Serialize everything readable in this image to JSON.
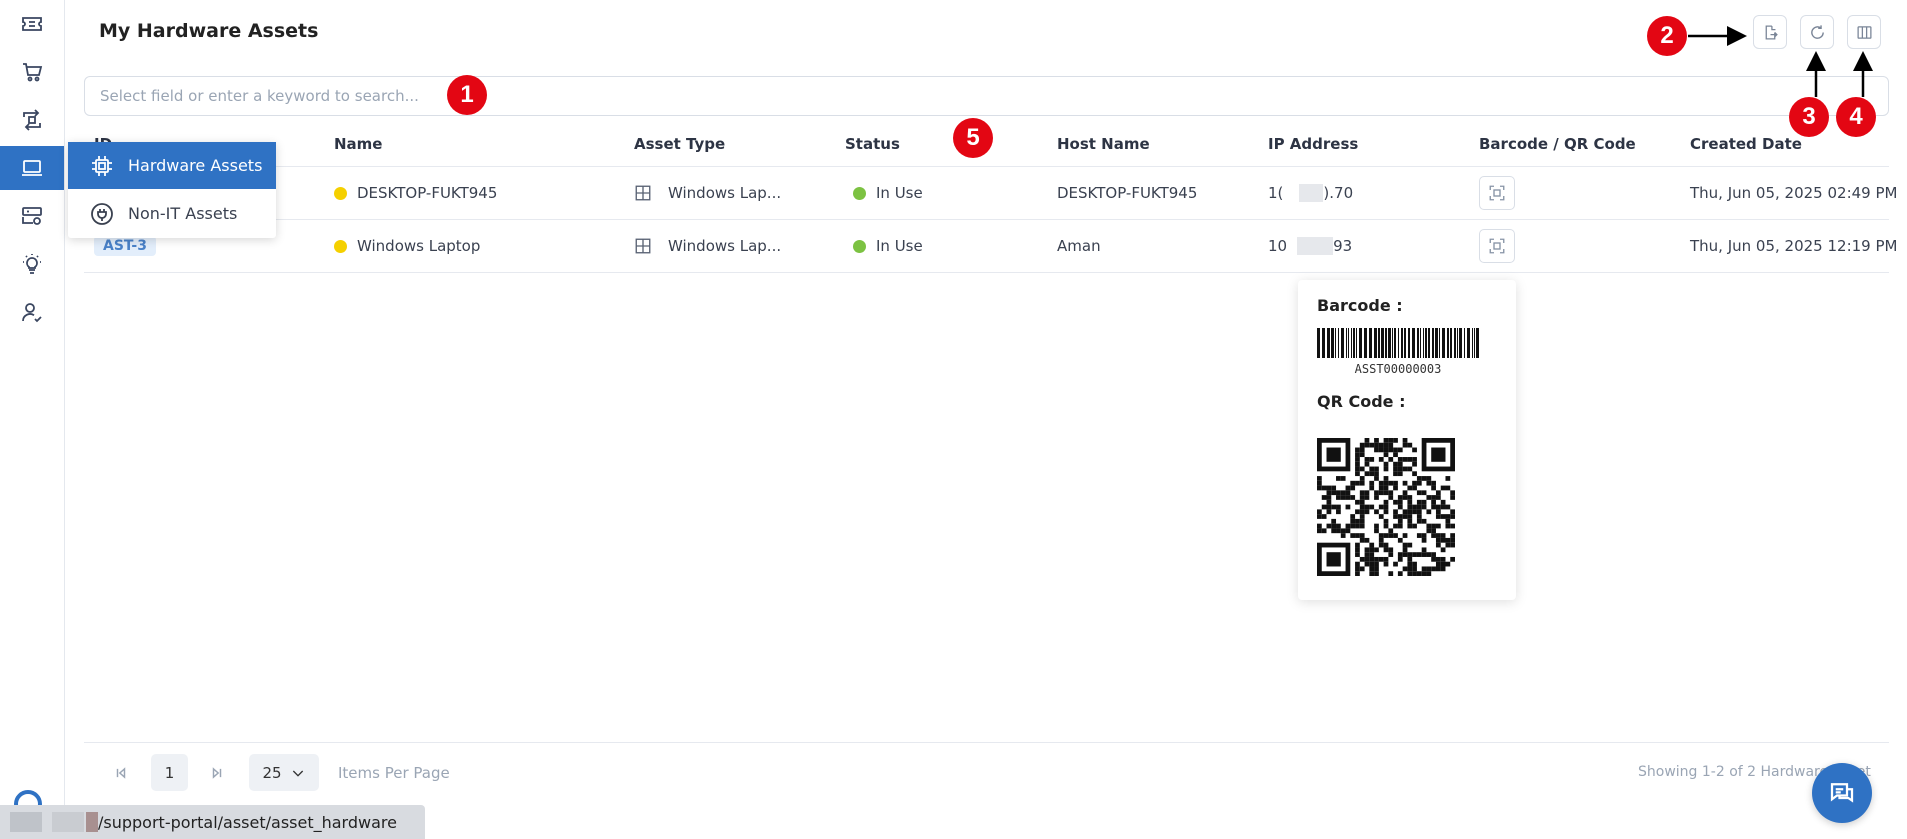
{
  "page": {
    "title": "My Hardware Assets"
  },
  "sidebar": {
    "items": [
      {
        "icon": "ticket-icon"
      },
      {
        "icon": "cart-icon"
      },
      {
        "icon": "transfer-icon"
      },
      {
        "icon": "laptop-icon",
        "active": true
      },
      {
        "icon": "server-icon"
      },
      {
        "icon": "lightbulb-icon"
      },
      {
        "icon": "user-check-icon"
      }
    ]
  },
  "toolbar": {
    "icons": [
      "export-icon",
      "refresh-icon",
      "columns-icon"
    ]
  },
  "search": {
    "placeholder": "Select field or enter a keyword to search..."
  },
  "asset_menu": {
    "items": [
      {
        "label": "Hardware Assets",
        "icon": "chip-icon",
        "active": true
      },
      {
        "label": "Non-IT Assets",
        "icon": "plug-icon",
        "active": false
      }
    ]
  },
  "table": {
    "columns": [
      "ID",
      "Name",
      "Asset Type",
      "Status",
      "Host Name",
      "IP Address",
      "Barcode / QR Code",
      "Created Date"
    ],
    "rows": [
      {
        "id": "",
        "name": "DESKTOP-FUKT945",
        "name_dot_color": "#f5d000",
        "asset_type": "Windows Lap...",
        "status": "In Use",
        "status_color": "#7cc242",
        "host_name": "DESKTOP-FUKT945",
        "ip_prefix": "1(",
        "ip_suffix": ").70",
        "created": "Thu, Jun 05, 2025 02:49 PM"
      },
      {
        "id": "AST-3",
        "name": "Windows Laptop",
        "name_dot_color": "#f5d000",
        "asset_type": "Windows Lap...",
        "status": "In Use",
        "status_color": "#7cc242",
        "host_name": "Aman",
        "ip_prefix": "10",
        "ip_suffix": "93",
        "created": "Thu, Jun 05, 2025 12:19 PM"
      }
    ]
  },
  "barcode_popup": {
    "barcode_label": "Barcode :",
    "barcode_value": "ASST00000003",
    "qr_label": "QR Code :"
  },
  "pagination": {
    "current_page": "1",
    "per_page": "25",
    "per_page_label": "Items Per Page",
    "showing": "Showing 1-2 of 2 Hardware Asset"
  },
  "statusbar": {
    "url_path": "/support-portal/asset/asset_hardware"
  },
  "annotations": [
    "1",
    "2",
    "3",
    "4",
    "5"
  ],
  "colors": {
    "accent": "#2f72c4",
    "marker": "#e30613"
  }
}
